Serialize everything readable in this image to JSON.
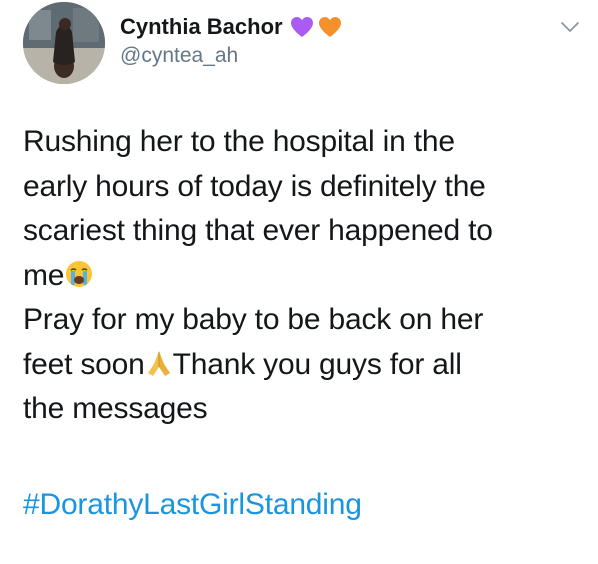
{
  "author": {
    "display_name": "Cynthia Bachor",
    "handle": "@cyntea_ah",
    "name_emojis": [
      "purple-heart",
      "orange-heart"
    ]
  },
  "tweet": {
    "lines": [
      "Rushing her to the hospital in the",
      "early hours of today is definitely the",
      "scariest thing that ever happened to",
      "me",
      "Pray for my baby to be back on her",
      "feet soon",
      "Thank you guys for all",
      "the messages"
    ],
    "hashtag": "#DorathyLastGirlStanding"
  },
  "icons": {
    "menu": "chevron-down",
    "crying": "loudly-crying-face",
    "pray": "folded-hands"
  },
  "colors": {
    "text": "#14171a",
    "secondary": "#657786",
    "link": "#1b95e0",
    "purple_heart": "#aa5cf2",
    "orange_heart": "#f5902b"
  }
}
